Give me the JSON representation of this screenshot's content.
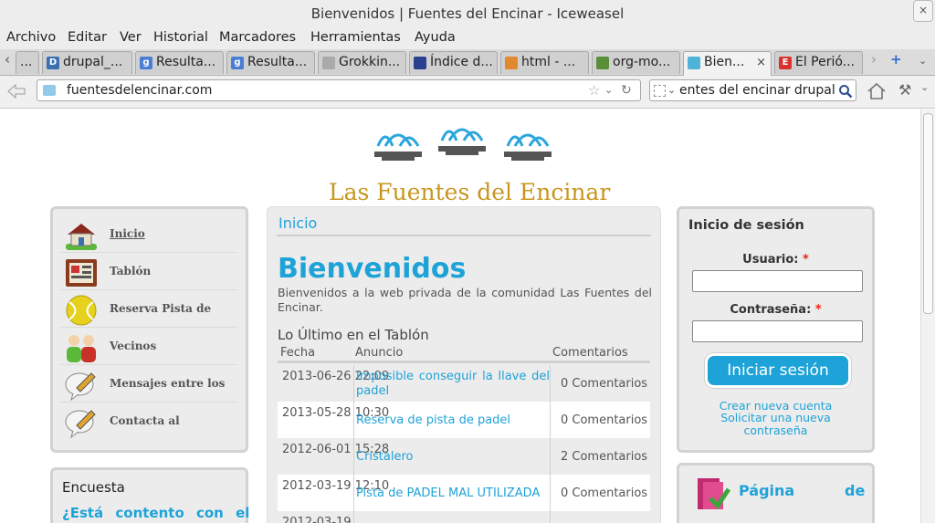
{
  "window": {
    "title": "Bienvenidos | Fuentes del Encinar - Iceweasel",
    "close_glyph": "×"
  },
  "menu": [
    "Archivo",
    "Editar",
    "Ver",
    "Historial",
    "Marcadores",
    "Herramientas",
    "Ayuda"
  ],
  "tabs": [
    {
      "label": "...",
      "fav": "",
      "fav_color": "#c9c9c9"
    },
    {
      "label": "drupal_...",
      "fav": "D",
      "fav_color": "#3a6fb0"
    },
    {
      "label": "Resulta...",
      "fav": "g",
      "fav_color": "#4a7dd4"
    },
    {
      "label": "Resulta...",
      "fav": "g",
      "fav_color": "#4a7dd4"
    },
    {
      "label": "Grokkin...",
      "fav": "",
      "fav_color": "#aaaaaa"
    },
    {
      "label": "Índice d...",
      "fav": "",
      "fav_color": "#2b3f8f"
    },
    {
      "label": "html - ...",
      "fav": "",
      "fav_color": "#e08a2d"
    },
    {
      "label": "org-mo...",
      "fav": "",
      "fav_color": "#5a8f3a"
    },
    {
      "label": "Bien...",
      "fav": "",
      "fav_color": "#4fb3d9",
      "active": true,
      "close": "×"
    },
    {
      "label": "El Perió...",
      "fav": "E",
      "fav_color": "#d9322e"
    }
  ],
  "nav": {
    "url": "fuentesdelencinar.com",
    "search_value": "entes del encinar drupal"
  },
  "site": {
    "logo_text": "Las Fuentes del Encinar",
    "sidebar": [
      {
        "label": "Inicio",
        "icon": "home-icon"
      },
      {
        "label": "Tablón",
        "icon": "board-icon"
      },
      {
        "label": "Reserva Pista de",
        "icon": "tennis-ball-icon"
      },
      {
        "label": "Vecinos",
        "icon": "people-icon"
      },
      {
        "label": "Mensajes entre los",
        "icon": "message-icon"
      },
      {
        "label": "Contacta al",
        "icon": "contact-icon"
      }
    ],
    "poll": {
      "title": "Encuesta",
      "question": "¿Está contento con el"
    },
    "main": {
      "breadcrumb": "Inicio",
      "heading": "Bienvenidos",
      "intro": "Bienvenidos a la web privada de la comunidad Las Fuentes del Encinar.",
      "section": "Lo Último en el Tablón",
      "columns": [
        "Fecha",
        "Anuncio",
        "Comentarios"
      ],
      "rows": [
        {
          "date": "2013-06-26 22:09",
          "title": "Imposible conseguir la llave del padel",
          "comments": "0 Comentarios"
        },
        {
          "date": "2013-05-28 10:30",
          "title": "Reserva de pista de padel",
          "comments": "0 Comentarios"
        },
        {
          "date": "2012-06-01 15:28",
          "title": "Cristalero",
          "comments": "2 Comentarios"
        },
        {
          "date": "2012-03-19 12:10",
          "title": "Pista de PADEL MAL UTILIZADA",
          "comments": "0 Comentarios"
        },
        {
          "date": "2012-03-19",
          "title": "",
          "comments": ""
        }
      ]
    },
    "login": {
      "title": "Inicio de sesión",
      "user_label": "Usuario:",
      "pass_label": "Contraseña:",
      "required_mark": "*",
      "submit": "Iniciar sesión",
      "create_account": "Crear nueva cuenta",
      "request_password": "Solicitar una nueva contraseña"
    },
    "page_box": {
      "word1": "Página",
      "word2": "de"
    }
  },
  "colors": {
    "accent": "#1ea3d8",
    "logo_gold": "#c8961e",
    "panel_bg": "#ececec"
  }
}
